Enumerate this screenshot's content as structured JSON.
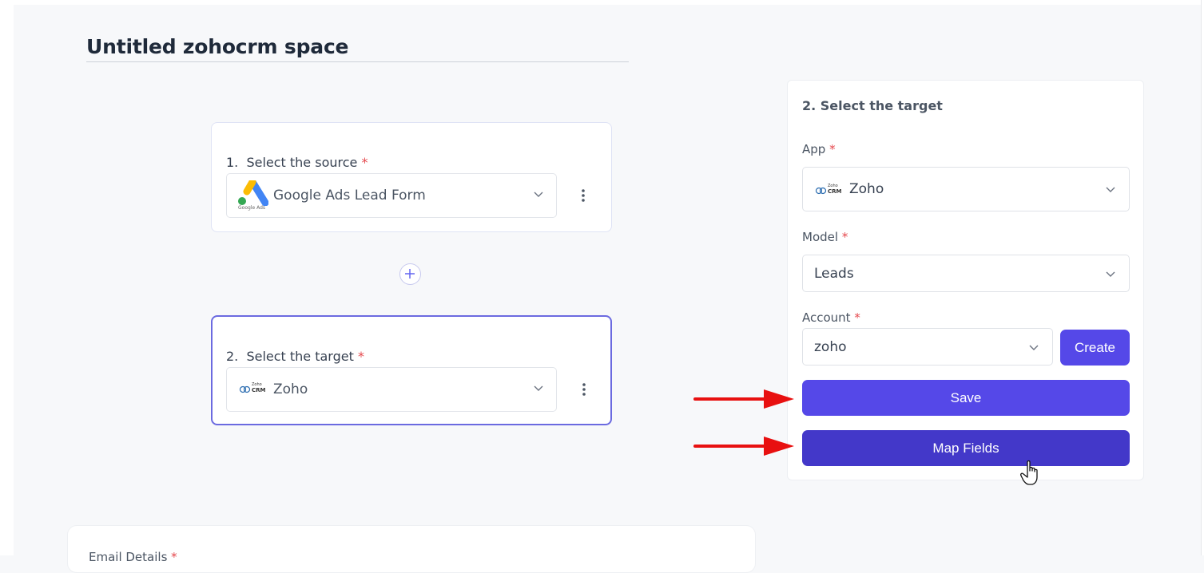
{
  "page": {
    "title": "Untitled zohocrm space"
  },
  "flow": {
    "steps": [
      {
        "number": "1.",
        "label": "Select the source",
        "required": "*",
        "app": "Google Ads Lead Form",
        "logo_caption": "Google Ads"
      },
      {
        "number": "2.",
        "label": "Select the target",
        "required": "*",
        "app": "Zoho",
        "logo_text_top": "Zoho",
        "logo_text_bottom": "CRM"
      }
    ]
  },
  "panel": {
    "title": "2. Select the target",
    "app": {
      "label": "App",
      "required": "*",
      "value": "Zoho",
      "logo_text_top": "Zoho",
      "logo_text_bottom": "CRM"
    },
    "model": {
      "label": "Model",
      "required": "*",
      "value": "Leads"
    },
    "account": {
      "label": "Account",
      "required": "*",
      "value": "zoho",
      "create_label": "Create"
    },
    "save_label": "Save",
    "map_fields_label": "Map Fields"
  },
  "bottom": {
    "label": "Email Details",
    "required": "*"
  },
  "colors": {
    "primary": "#5548e8",
    "primary_dark": "#4338c9",
    "required": "#e5484d",
    "annotation_arrow": "#e81010"
  }
}
